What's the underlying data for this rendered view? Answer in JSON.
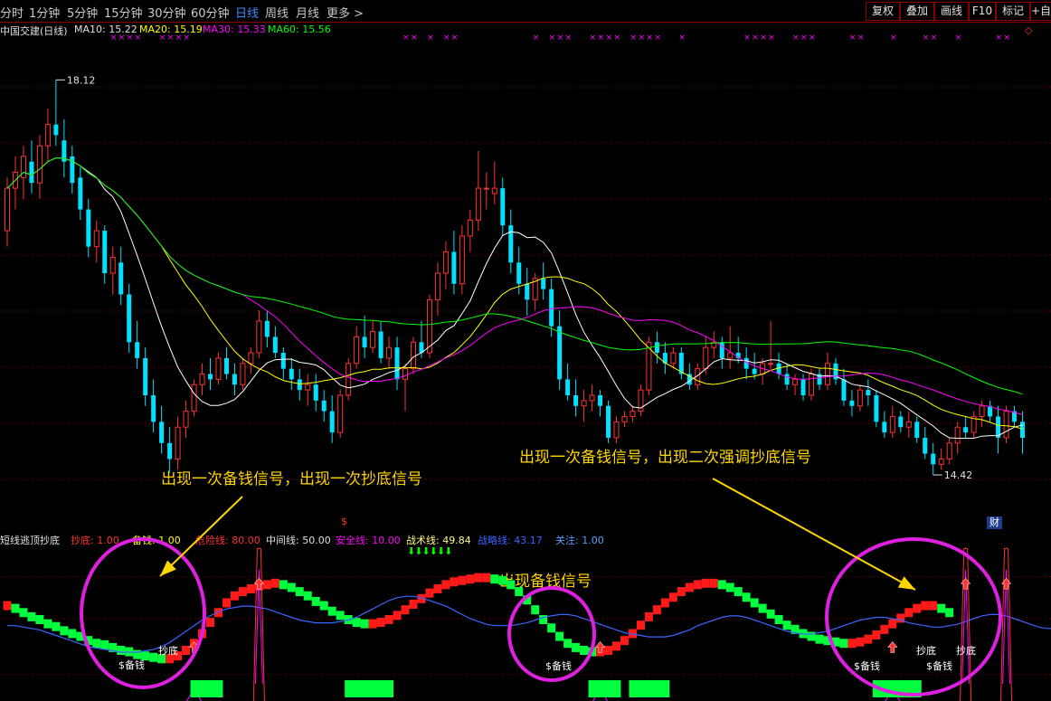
{
  "toolbar": {
    "tabs": [
      "分时",
      "1分钟",
      "5分钟",
      "15分钟",
      "30分钟",
      "60分钟",
      "日线",
      "周线",
      "月线",
      "更多 >"
    ],
    "active_tab": "日线",
    "right_buttons": [
      "复权",
      "叠加",
      "画线",
      "F10",
      "标记",
      "+自选"
    ]
  },
  "main_legend": {
    "title": "中国交建(日线)",
    "ma10": "MA10: 15.22",
    "ma20": "MA20: 15.19",
    "ma30": "MA30: 15.33",
    "ma60": "MA60: 15.56",
    "marker_glyph": "×",
    "dividend_marker": "$",
    "diamond": "◇"
  },
  "price_labels": {
    "high": "18.12",
    "low": "14.42"
  },
  "annotations": {
    "a1": "出现一次备钱信号，出现一次抄底信号",
    "a2": "出现一次备钱信号，出现二次强调抄底信号",
    "a3": "出现备钱信号"
  },
  "indicator_legend": {
    "name": "短线逃顶抄底",
    "chaodi": "抄底: 1.00",
    "beiqian": "备钱: 1.00",
    "weixian": "危险线: 80.00",
    "zhongjian": "中间线: 50.00",
    "anquan": "安全线: 10.00",
    "zhanshu": "战术线: 49.84",
    "zhanlue": "战略线: 43.17",
    "guanzhu": "关注: 1.00"
  },
  "indicator_labels": {
    "beiqian": "$备钱",
    "chaodi": "抄底",
    "down_arrows": "⬇⬇⬇⬇⬇⬇",
    "cai": "财"
  },
  "colors": {
    "up": "#ff3232",
    "down": "#00e0ff",
    "ma10": "#ffffff",
    "ma20": "#ffff00",
    "ma30": "#ff00ff",
    "ma60": "#00ff00",
    "block_up": "#ff1a1a",
    "block_down": "#00ff3c",
    "ring": "#e020e0",
    "arrow": "#ffd700",
    "zhanlue": "#3c64ff"
  },
  "chart_data": {
    "type": "candlestick",
    "ylim": [
      14.0,
      18.6
    ],
    "candles": [
      {
        "o": 16.7,
        "h": 17.2,
        "l": 16.55,
        "c": 17.1
      },
      {
        "o": 17.1,
        "h": 17.4,
        "l": 16.9,
        "c": 17.25
      },
      {
        "o": 17.2,
        "h": 17.5,
        "l": 17.0,
        "c": 17.4
      },
      {
        "o": 17.35,
        "h": 17.55,
        "l": 17.05,
        "c": 17.15
      },
      {
        "o": 17.15,
        "h": 17.6,
        "l": 17.0,
        "c": 17.5
      },
      {
        "o": 17.5,
        "h": 17.85,
        "l": 17.35,
        "c": 17.7
      },
      {
        "o": 17.7,
        "h": 18.12,
        "l": 17.5,
        "c": 17.6
      },
      {
        "o": 17.55,
        "h": 17.75,
        "l": 17.2,
        "c": 17.35
      },
      {
        "o": 17.4,
        "h": 17.5,
        "l": 17.05,
        "c": 17.15
      },
      {
        "o": 17.2,
        "h": 17.3,
        "l": 16.8,
        "c": 16.9
      },
      {
        "o": 16.9,
        "h": 17.0,
        "l": 16.45,
        "c": 16.55
      },
      {
        "o": 16.55,
        "h": 16.8,
        "l": 16.4,
        "c": 16.7
      },
      {
        "o": 16.7,
        "h": 16.75,
        "l": 16.2,
        "c": 16.3
      },
      {
        "o": 16.3,
        "h": 16.55,
        "l": 16.1,
        "c": 16.45
      },
      {
        "o": 16.4,
        "h": 16.55,
        "l": 16.0,
        "c": 16.1
      },
      {
        "o": 16.1,
        "h": 16.2,
        "l": 15.55,
        "c": 15.65
      },
      {
        "o": 15.65,
        "h": 15.85,
        "l": 15.4,
        "c": 15.5
      },
      {
        "o": 15.5,
        "h": 15.6,
        "l": 15.05,
        "c": 15.15
      },
      {
        "o": 15.15,
        "h": 15.3,
        "l": 14.8,
        "c": 14.9
      },
      {
        "o": 14.9,
        "h": 15.05,
        "l": 14.6,
        "c": 14.7
      },
      {
        "o": 14.7,
        "h": 14.85,
        "l": 14.42,
        "c": 14.55
      },
      {
        "o": 14.55,
        "h": 14.95,
        "l": 14.45,
        "c": 14.85
      },
      {
        "o": 14.85,
        "h": 15.1,
        "l": 14.75,
        "c": 15.0
      },
      {
        "o": 15.0,
        "h": 15.3,
        "l": 14.95,
        "c": 15.25
      },
      {
        "o": 15.25,
        "h": 15.45,
        "l": 15.15,
        "c": 15.35
      },
      {
        "o": 15.35,
        "h": 15.5,
        "l": 15.2,
        "c": 15.3
      },
      {
        "o": 15.3,
        "h": 15.55,
        "l": 15.25,
        "c": 15.5
      },
      {
        "o": 15.5,
        "h": 15.6,
        "l": 15.3,
        "c": 15.35
      },
      {
        "o": 15.35,
        "h": 15.45,
        "l": 15.15,
        "c": 15.25
      },
      {
        "o": 15.25,
        "h": 15.5,
        "l": 15.2,
        "c": 15.45
      },
      {
        "o": 15.45,
        "h": 15.6,
        "l": 15.35,
        "c": 15.55
      },
      {
        "o": 15.55,
        "h": 15.95,
        "l": 15.5,
        "c": 15.85
      },
      {
        "o": 15.85,
        "h": 15.95,
        "l": 15.6,
        "c": 15.7
      },
      {
        "o": 15.7,
        "h": 15.8,
        "l": 15.5,
        "c": 15.55
      },
      {
        "o": 15.55,
        "h": 15.6,
        "l": 15.3,
        "c": 15.4
      },
      {
        "o": 15.4,
        "h": 15.5,
        "l": 15.2,
        "c": 15.3
      },
      {
        "o": 15.3,
        "h": 15.4,
        "l": 15.1,
        "c": 15.2
      },
      {
        "o": 15.2,
        "h": 15.35,
        "l": 15.05,
        "c": 15.25
      },
      {
        "o": 15.25,
        "h": 15.35,
        "l": 15.0,
        "c": 15.1
      },
      {
        "o": 15.1,
        "h": 15.2,
        "l": 14.9,
        "c": 15.0
      },
      {
        "o": 15.0,
        "h": 15.15,
        "l": 14.7,
        "c": 14.8
      },
      {
        "o": 14.8,
        "h": 15.2,
        "l": 14.75,
        "c": 15.15
      },
      {
        "o": 15.15,
        "h": 15.5,
        "l": 15.1,
        "c": 15.45
      },
      {
        "o": 15.45,
        "h": 15.8,
        "l": 15.4,
        "c": 15.7
      },
      {
        "o": 15.7,
        "h": 15.9,
        "l": 15.5,
        "c": 15.6
      },
      {
        "o": 15.6,
        "h": 15.85,
        "l": 15.55,
        "c": 15.75
      },
      {
        "o": 15.75,
        "h": 15.85,
        "l": 15.45,
        "c": 15.5
      },
      {
        "o": 15.5,
        "h": 15.7,
        "l": 15.4,
        "c": 15.6
      },
      {
        "o": 15.6,
        "h": 15.7,
        "l": 15.2,
        "c": 15.3
      },
      {
        "o": 15.3,
        "h": 15.45,
        "l": 15.0,
        "c": 15.4
      },
      {
        "o": 15.4,
        "h": 15.7,
        "l": 15.35,
        "c": 15.65
      },
      {
        "o": 15.65,
        "h": 15.85,
        "l": 15.5,
        "c": 15.55
      },
      {
        "o": 15.55,
        "h": 16.1,
        "l": 15.5,
        "c": 16.05
      },
      {
        "o": 16.05,
        "h": 16.4,
        "l": 15.9,
        "c": 16.3
      },
      {
        "o": 16.3,
        "h": 16.6,
        "l": 16.15,
        "c": 16.5
      },
      {
        "o": 16.5,
        "h": 16.7,
        "l": 16.1,
        "c": 16.2
      },
      {
        "o": 16.2,
        "h": 16.75,
        "l": 16.1,
        "c": 16.65
      },
      {
        "o": 16.65,
        "h": 16.9,
        "l": 16.5,
        "c": 16.8
      },
      {
        "o": 16.8,
        "h": 17.45,
        "l": 16.7,
        "c": 17.1
      },
      {
        "o": 17.1,
        "h": 17.25,
        "l": 16.9,
        "c": 17.1
      },
      {
        "o": 17.05,
        "h": 17.35,
        "l": 16.95,
        "c": 17.1
      },
      {
        "o": 17.1,
        "h": 17.2,
        "l": 16.65,
        "c": 16.75
      },
      {
        "o": 16.75,
        "h": 16.9,
        "l": 16.3,
        "c": 16.4
      },
      {
        "o": 16.4,
        "h": 16.55,
        "l": 16.1,
        "c": 16.2
      },
      {
        "o": 16.2,
        "h": 16.35,
        "l": 15.9,
        "c": 16.05
      },
      {
        "o": 16.05,
        "h": 16.3,
        "l": 15.95,
        "c": 16.25
      },
      {
        "o": 16.25,
        "h": 16.4,
        "l": 16.05,
        "c": 16.15
      },
      {
        "o": 16.15,
        "h": 16.25,
        "l": 15.7,
        "c": 15.8
      },
      {
        "o": 15.8,
        "h": 15.95,
        "l": 15.2,
        "c": 15.3
      },
      {
        "o": 15.3,
        "h": 15.45,
        "l": 15.1,
        "c": 15.15
      },
      {
        "o": 15.15,
        "h": 15.3,
        "l": 14.95,
        "c": 15.05
      },
      {
        "o": 15.05,
        "h": 15.2,
        "l": 14.9,
        "c": 15.1
      },
      {
        "o": 15.1,
        "h": 15.25,
        "l": 15.0,
        "c": 15.15
      },
      {
        "o": 15.15,
        "h": 15.2,
        "l": 14.95,
        "c": 15.05
      },
      {
        "o": 15.05,
        "h": 15.1,
        "l": 14.7,
        "c": 14.75
      },
      {
        "o": 14.75,
        "h": 14.95,
        "l": 14.7,
        "c": 14.9
      },
      {
        "o": 14.9,
        "h": 15.0,
        "l": 14.85,
        "c": 14.95
      },
      {
        "o": 14.95,
        "h": 15.05,
        "l": 14.9,
        "c": 15.0
      },
      {
        "o": 15.0,
        "h": 15.25,
        "l": 14.95,
        "c": 15.2
      },
      {
        "o": 15.2,
        "h": 15.7,
        "l": 15.15,
        "c": 15.65
      },
      {
        "o": 15.65,
        "h": 15.75,
        "l": 15.45,
        "c": 15.55
      },
      {
        "o": 15.55,
        "h": 15.65,
        "l": 15.35,
        "c": 15.45
      },
      {
        "o": 15.45,
        "h": 15.6,
        "l": 15.4,
        "c": 15.55
      },
      {
        "o": 15.55,
        "h": 15.6,
        "l": 15.3,
        "c": 15.35
      },
      {
        "o": 15.35,
        "h": 15.45,
        "l": 15.2,
        "c": 15.25
      },
      {
        "o": 15.25,
        "h": 15.45,
        "l": 15.2,
        "c": 15.4
      },
      {
        "o": 15.4,
        "h": 15.7,
        "l": 15.35,
        "c": 15.6
      },
      {
        "o": 15.6,
        "h": 15.75,
        "l": 15.5,
        "c": 15.65
      },
      {
        "o": 15.65,
        "h": 15.7,
        "l": 15.4,
        "c": 15.5
      },
      {
        "o": 15.5,
        "h": 15.8,
        "l": 15.4,
        "c": 15.55
      },
      {
        "o": 15.55,
        "h": 15.7,
        "l": 15.45,
        "c": 15.5
      },
      {
        "o": 15.5,
        "h": 15.6,
        "l": 15.3,
        "c": 15.4
      },
      {
        "o": 15.4,
        "h": 15.55,
        "l": 15.3,
        "c": 15.35
      },
      {
        "o": 15.35,
        "h": 15.5,
        "l": 15.25,
        "c": 15.45
      },
      {
        "o": 15.45,
        "h": 15.85,
        "l": 15.4,
        "c": 15.45
      },
      {
        "o": 15.45,
        "h": 15.55,
        "l": 15.3,
        "c": 15.35
      },
      {
        "o": 15.35,
        "h": 15.45,
        "l": 15.2,
        "c": 15.25
      },
      {
        "o": 15.25,
        "h": 15.35,
        "l": 15.15,
        "c": 15.3
      },
      {
        "o": 15.3,
        "h": 15.35,
        "l": 15.1,
        "c": 15.15
      },
      {
        "o": 15.15,
        "h": 15.4,
        "l": 15.1,
        "c": 15.35
      },
      {
        "o": 15.35,
        "h": 15.4,
        "l": 15.2,
        "c": 15.25
      },
      {
        "o": 15.25,
        "h": 15.55,
        "l": 15.2,
        "c": 15.45
      },
      {
        "o": 15.45,
        "h": 15.5,
        "l": 15.25,
        "c": 15.3
      },
      {
        "o": 15.3,
        "h": 15.4,
        "l": 15.05,
        "c": 15.1
      },
      {
        "o": 15.1,
        "h": 15.2,
        "l": 14.95,
        "c": 15.05
      },
      {
        "o": 15.05,
        "h": 15.25,
        "l": 15.0,
        "c": 15.2
      },
      {
        "o": 15.2,
        "h": 15.3,
        "l": 15.05,
        "c": 15.15
      },
      {
        "o": 15.15,
        "h": 15.2,
        "l": 14.85,
        "c": 14.9
      },
      {
        "o": 14.9,
        "h": 15.0,
        "l": 14.75,
        "c": 14.8
      },
      {
        "o": 14.8,
        "h": 15.05,
        "l": 14.75,
        "c": 14.95
      },
      {
        "o": 14.95,
        "h": 15.0,
        "l": 14.8,
        "c": 14.85
      },
      {
        "o": 14.85,
        "h": 15.0,
        "l": 14.75,
        "c": 14.9
      },
      {
        "o": 14.9,
        "h": 14.95,
        "l": 14.7,
        "c": 14.75
      },
      {
        "o": 14.75,
        "h": 14.85,
        "l": 14.55,
        "c": 14.6
      },
      {
        "o": 14.6,
        "h": 14.7,
        "l": 14.4,
        "c": 14.5
      },
      {
        "o": 14.5,
        "h": 14.65,
        "l": 14.45,
        "c": 14.55
      },
      {
        "o": 14.55,
        "h": 14.75,
        "l": 14.5,
        "c": 14.7
      },
      {
        "o": 14.7,
        "h": 14.9,
        "l": 14.6,
        "c": 14.85
      },
      {
        "o": 14.85,
        "h": 14.95,
        "l": 14.75,
        "c": 14.8
      },
      {
        "o": 14.8,
        "h": 15.0,
        "l": 14.75,
        "c": 14.95
      },
      {
        "o": 14.95,
        "h": 15.1,
        "l": 14.85,
        "c": 15.05
      },
      {
        "o": 15.05,
        "h": 15.1,
        "l": 14.9,
        "c": 14.95
      },
      {
        "o": 14.95,
        "h": 15.05,
        "l": 14.6,
        "c": 14.75
      },
      {
        "o": 14.75,
        "h": 15.05,
        "l": 14.7,
        "c": 15.0
      },
      {
        "o": 15.0,
        "h": 15.05,
        "l": 14.85,
        "c": 14.9
      },
      {
        "o": 14.9,
        "h": 15.0,
        "l": 14.6,
        "c": 14.75
      }
    ],
    "ind_ylim": [
      -5,
      105
    ],
    "ind_line": [
      60,
      58,
      55,
      52,
      50,
      47,
      45,
      42,
      40,
      38,
      35,
      33,
      32,
      30,
      28,
      27,
      25,
      24,
      23,
      22,
      22,
      24,
      28,
      33,
      40,
      48,
      55,
      62,
      67,
      70,
      72,
      74,
      75,
      76,
      75,
      73,
      70,
      67,
      63,
      60,
      56,
      53,
      50,
      48,
      47,
      47,
      48,
      50,
      53,
      57,
      61,
      65,
      69,
      72,
      75,
      77,
      78,
      79,
      80,
      80,
      79,
      78,
      75,
      70,
      64,
      57,
      50,
      44,
      38,
      33,
      30,
      28,
      27,
      27,
      28,
      31,
      35,
      40,
      46,
      52,
      57,
      62,
      66,
      70,
      73,
      75,
      76,
      76,
      75,
      73,
      70,
      66,
      62,
      58,
      54,
      50,
      46,
      43,
      40,
      38,
      36,
      35,
      34,
      33,
      33,
      34,
      36,
      39,
      43,
      47,
      51,
      55,
      58,
      60,
      60,
      58,
      55
    ],
    "blue_line": [
      45,
      45,
      44,
      43,
      42,
      40,
      38,
      36,
      34,
      32,
      30,
      29,
      28,
      27,
      26,
      26,
      26,
      27,
      28,
      30,
      33,
      37,
      41,
      45,
      49,
      52,
      55,
      57,
      58,
      59,
      59,
      58,
      57,
      55,
      53,
      51,
      49,
      48,
      47,
      47,
      47,
      48,
      49,
      51,
      54,
      57,
      60,
      63,
      65,
      66,
      66,
      65,
      63,
      61,
      59,
      56,
      53,
      50,
      48,
      46,
      45,
      45,
      45,
      46,
      47,
      49,
      51,
      52,
      53,
      53,
      52,
      50,
      48,
      46,
      44,
      42,
      40,
      39,
      38,
      37,
      37,
      37,
      38,
      40,
      42,
      45,
      47,
      49,
      51,
      52,
      52,
      51,
      49,
      47,
      45,
      43,
      41,
      40,
      39,
      39,
      40,
      41,
      43,
      45,
      47,
      49,
      50,
      51,
      51,
      50,
      49,
      47,
      46,
      45,
      44,
      44,
      45,
      46,
      48,
      50,
      52,
      53,
      53,
      52,
      50,
      48,
      46,
      44,
      43,
      43
    ],
    "beiqian_signals": [
      23,
      73,
      109
    ],
    "chaodi_signals": [
      31,
      118,
      123
    ],
    "bottom_bars": [
      [
        23,
        26
      ],
      [
        42,
        47
      ],
      [
        72,
        75
      ],
      [
        77,
        81
      ],
      [
        107,
        112
      ]
    ]
  }
}
